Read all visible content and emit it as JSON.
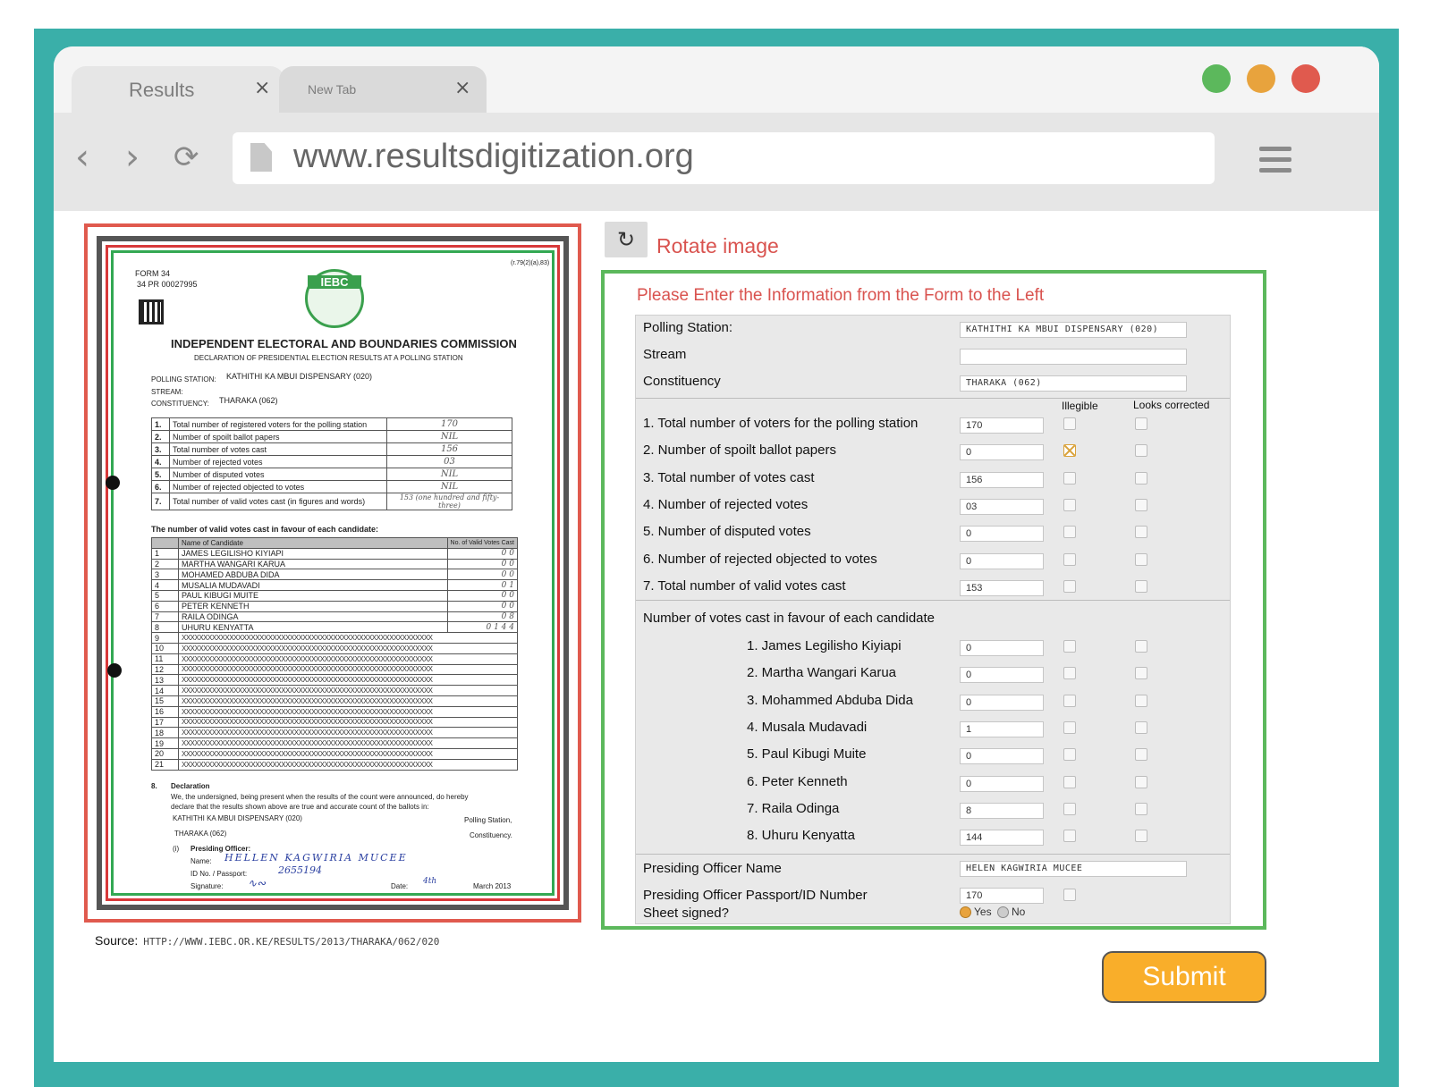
{
  "browser": {
    "tabs": [
      {
        "label": "Results"
      },
      {
        "label": "New Tab"
      }
    ],
    "url": "www.resultsdigitization.org",
    "window_dots": [
      "#5cb85c",
      "#e8a33d",
      "#e05a4e"
    ]
  },
  "scan": {
    "form_no": "FORM 34",
    "serial": "34 PR 00027995",
    "corner_ref": "(r.79(2)(a),83)",
    "seal_text": "IEBC",
    "title": "INDEPENDENT ELECTORAL AND BOUNDARIES COMMISSION",
    "subtitle": "DECLARATION OF PRESIDENTIAL ELECTION RESULTS AT A POLLING STATION",
    "polling_station_label": "POLLING STATION:",
    "polling_station": "KATHITHI KA MBUI DISPENSARY (020)",
    "stream_label": "STREAM:",
    "constituency_label": "CONSTITUENCY:",
    "constituency": "THARAKA (062)",
    "summary_rows": [
      {
        "n": "1.",
        "label": "Total number of registered voters for the polling station",
        "value": "170"
      },
      {
        "n": "2.",
        "label": "Number of spoilt ballot papers",
        "value": "NIL"
      },
      {
        "n": "3.",
        "label": "Total number of votes cast",
        "value": "156"
      },
      {
        "n": "4.",
        "label": "Number of rejected votes",
        "value": "03"
      },
      {
        "n": "5.",
        "label": "Number of disputed votes",
        "value": "NIL"
      },
      {
        "n": "6.",
        "label": "Number of rejected objected to votes",
        "value": "NIL"
      },
      {
        "n": "7.",
        "label": "Total number of valid votes cast (in figures and words)",
        "value": "153 (one hundred and fifty-three)"
      }
    ],
    "candidates_heading": "The number of valid votes cast in favour of each candidate:",
    "cand_col_name": "Name of Candidate",
    "cand_col_votes": "No. of Valid Votes Cast",
    "candidates": [
      {
        "n": "1",
        "name": "JAMES LEGILISHO KIYIAPI",
        "votes": "0 0"
      },
      {
        "n": "2",
        "name": "MARTHA WANGARI KARUA",
        "votes": "0 0"
      },
      {
        "n": "3",
        "name": "MOHAMED ABDUBA DIDA",
        "votes": "0 0"
      },
      {
        "n": "4",
        "name": "MUSALIA MUDAVADI",
        "votes": "0 1"
      },
      {
        "n": "5",
        "name": "PAUL KIBUGI MUITE",
        "votes": "0 0"
      },
      {
        "n": "6",
        "name": "PETER KENNETH",
        "votes": "0 0"
      },
      {
        "n": "7",
        "name": "RAILA ODINGA",
        "votes": "0 8"
      },
      {
        "n": "8",
        "name": "UHURU KENYATTA",
        "votes": "0 1 4 4"
      }
    ],
    "crossed_rows": [
      {
        "n": "9",
        "name": "XXXXXXXXXXXXXXXXXXXXXXXXXXXXXXXXXXXXXXXXXXXXXXXXXXXXXXXXXX"
      },
      {
        "n": "10",
        "name": "XXXXXXXXXXXXXXXXXXXXXXXXXXXXXXXXXXXXXXXXXXXXXXXXXXXXXXXXXX"
      },
      {
        "n": "11",
        "name": "XXXXXXXXXXXXXXXXXXXXXXXXXXXXXXXXXXXXXXXXXXXXXXXXXXXXXXXXXX"
      },
      {
        "n": "12",
        "name": "XXXXXXXXXXXXXXXXXXXXXXXXXXXXXXXXXXXXXXXXXXXXXXXXXXXXXXXXXX"
      },
      {
        "n": "13",
        "name": "XXXXXXXXXXXXXXXXXXXXXXXXXXXXXXXXXXXXXXXXXXXXXXXXXXXXXXXXXX"
      },
      {
        "n": "14",
        "name": "XXXXXXXXXXXXXXXXXXXXXXXXXXXXXXXXXXXXXXXXXXXXXXXXXXXXXXXXXX"
      },
      {
        "n": "15",
        "name": "XXXXXXXXXXXXXXXXXXXXXXXXXXXXXXXXXXXXXXXXXXXXXXXXXXXXXXXXXX"
      },
      {
        "n": "16",
        "name": "XXXXXXXXXXXXXXXXXXXXXXXXXXXXXXXXXXXXXXXXXXXXXXXXXXXXXXXXXX"
      },
      {
        "n": "17",
        "name": "XXXXXXXXXXXXXXXXXXXXXXXXXXXXXXXXXXXXXXXXXXXXXXXXXXXXXXXXXX"
      },
      {
        "n": "18",
        "name": "XXXXXXXXXXXXXXXXXXXXXXXXXXXXXXXXXXXXXXXXXXXXXXXXXXXXXXXXXX"
      },
      {
        "n": "19",
        "name": "XXXXXXXXXXXXXXXXXXXXXXXXXXXXXXXXXXXXXXXXXXXXXXXXXXXXXXXXXX"
      },
      {
        "n": "20",
        "name": "XXXXXXXXXXXXXXXXXXXXXXXXXXXXXXXXXXXXXXXXXXXXXXXXXXXXXXXXXX"
      },
      {
        "n": "21",
        "name": "XXXXXXXXXXXXXXXXXXXXXXXXXXXXXXXXXXXXXXXXXXXXXXXXXXXXXXXXXX"
      }
    ],
    "declaration_no": "8.",
    "declaration_title": "Declaration",
    "declaration_line1": "We, the undersigned, being present when the results of the count were announced, do hereby",
    "declaration_line2": "declare that the results shown above are true and accurate count of the ballots in:",
    "decl_station": "KATHITHI KA MBUI DISPENSARY (020)",
    "decl_station_suffix": "Polling Station,",
    "decl_constituency": "THARAKA (062)",
    "decl_constituency_suffix": "Constituency.",
    "officer_no": "(i)",
    "officer_heading": "Presiding Officer:",
    "name_label": "Name:",
    "officer_name": "HELLEN KAGWIRIA MUCEE",
    "id_label": "ID No. / Passport:",
    "officer_id": "2655194",
    "signature_label": "Signature:",
    "date_label": "Date:",
    "date_day": "4th",
    "date_month": "March 2013"
  },
  "source": {
    "label": "Source:",
    "url": "HTTP://WWW.IEBC.OR.KE/RESULTS/2013/THARAKA/062/020"
  },
  "rotate": {
    "label": "Rotate image"
  },
  "form": {
    "title": "Please Enter the Information from the Form to the Left",
    "polling_station_label": "Polling Station:",
    "polling_station_value": "KATHITHI KA MBUI DISPENSARY (020)",
    "stream_label": "Stream",
    "stream_value": "",
    "constituency_label": "Constituency",
    "constituency_value": "THARAKA (062)",
    "col_illegible": "Illegible",
    "col_corrected": "Looks corrected",
    "fields": [
      {
        "label": "1. Total number of voters for the polling station",
        "value": "170",
        "illegible": false,
        "corrected": false
      },
      {
        "label": "2. Number of spoilt ballot papers",
        "value": "0",
        "illegible": true,
        "corrected": false
      },
      {
        "label": "3. Total number of votes cast",
        "value": "156",
        "illegible": false,
        "corrected": false
      },
      {
        "label": "4. Number of rejected votes",
        "value": "03",
        "illegible": false,
        "corrected": false
      },
      {
        "label": "5. Number of disputed votes",
        "value": "0",
        "illegible": false,
        "corrected": false
      },
      {
        "label": "6. Number of rejected objected to votes",
        "value": "0",
        "illegible": false,
        "corrected": false
      },
      {
        "label": "7. Total number of valid votes cast",
        "value": "153",
        "illegible": false,
        "corrected": false
      }
    ],
    "candidates_heading": "Number of votes cast in favour of each candidate",
    "candidates": [
      {
        "label": "1. James Legilisho Kiyiapi",
        "value": "0"
      },
      {
        "label": "2. Martha Wangari Karua",
        "value": "0"
      },
      {
        "label": "3. Mohammed Abduba Dida",
        "value": "0"
      },
      {
        "label": "4. Musala Mudavadi",
        "value": "1"
      },
      {
        "label": "5. Paul Kibugi Muite",
        "value": "0"
      },
      {
        "label": "6. Peter Kenneth",
        "value": "0"
      },
      {
        "label": "7. Raila Odinga",
        "value": "8"
      },
      {
        "label": "8. Uhuru Kenyatta",
        "value": "144"
      }
    ],
    "officer_name_label": "Presiding Officer Name",
    "officer_name_value": "HELEN KAGWIRIA MUCEE",
    "officer_id_label": "Presiding Officer Passport/ID Number",
    "officer_id_value": "170",
    "sheet_signed_label": "Sheet signed?",
    "sheet_signed_yes": "Yes",
    "sheet_signed_no": "No",
    "sheet_signed": "Yes"
  },
  "submit": {
    "label": "Submit"
  }
}
